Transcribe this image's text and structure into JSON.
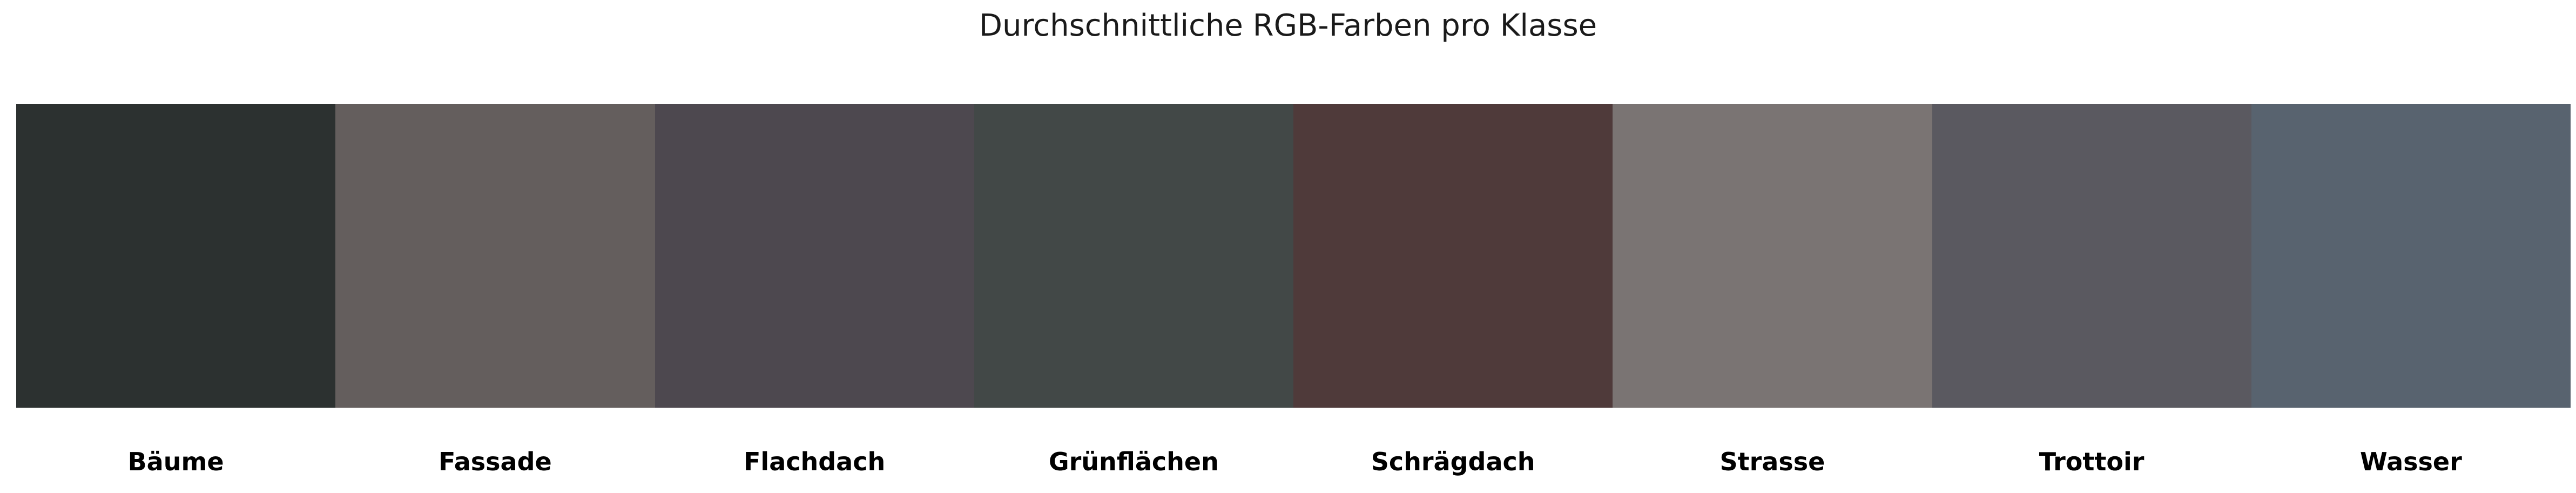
{
  "chart_data": {
    "type": "bar",
    "title": "Durchschnittliche RGB-Farben pro Klasse",
    "xlabel": "",
    "ylabel": "",
    "grid": false,
    "categories": [
      "Bäume",
      "Fassade",
      "Flachdach",
      "Grünflächen",
      "Schrägdach",
      "Strasse",
      "Trottoir",
      "Wasser"
    ],
    "colors": [
      "#2c3130",
      "#645e5d",
      "#4d484f",
      "#424847",
      "#4f3a3a",
      "#7a7473",
      "#5a5960",
      "#58636f"
    ]
  }
}
